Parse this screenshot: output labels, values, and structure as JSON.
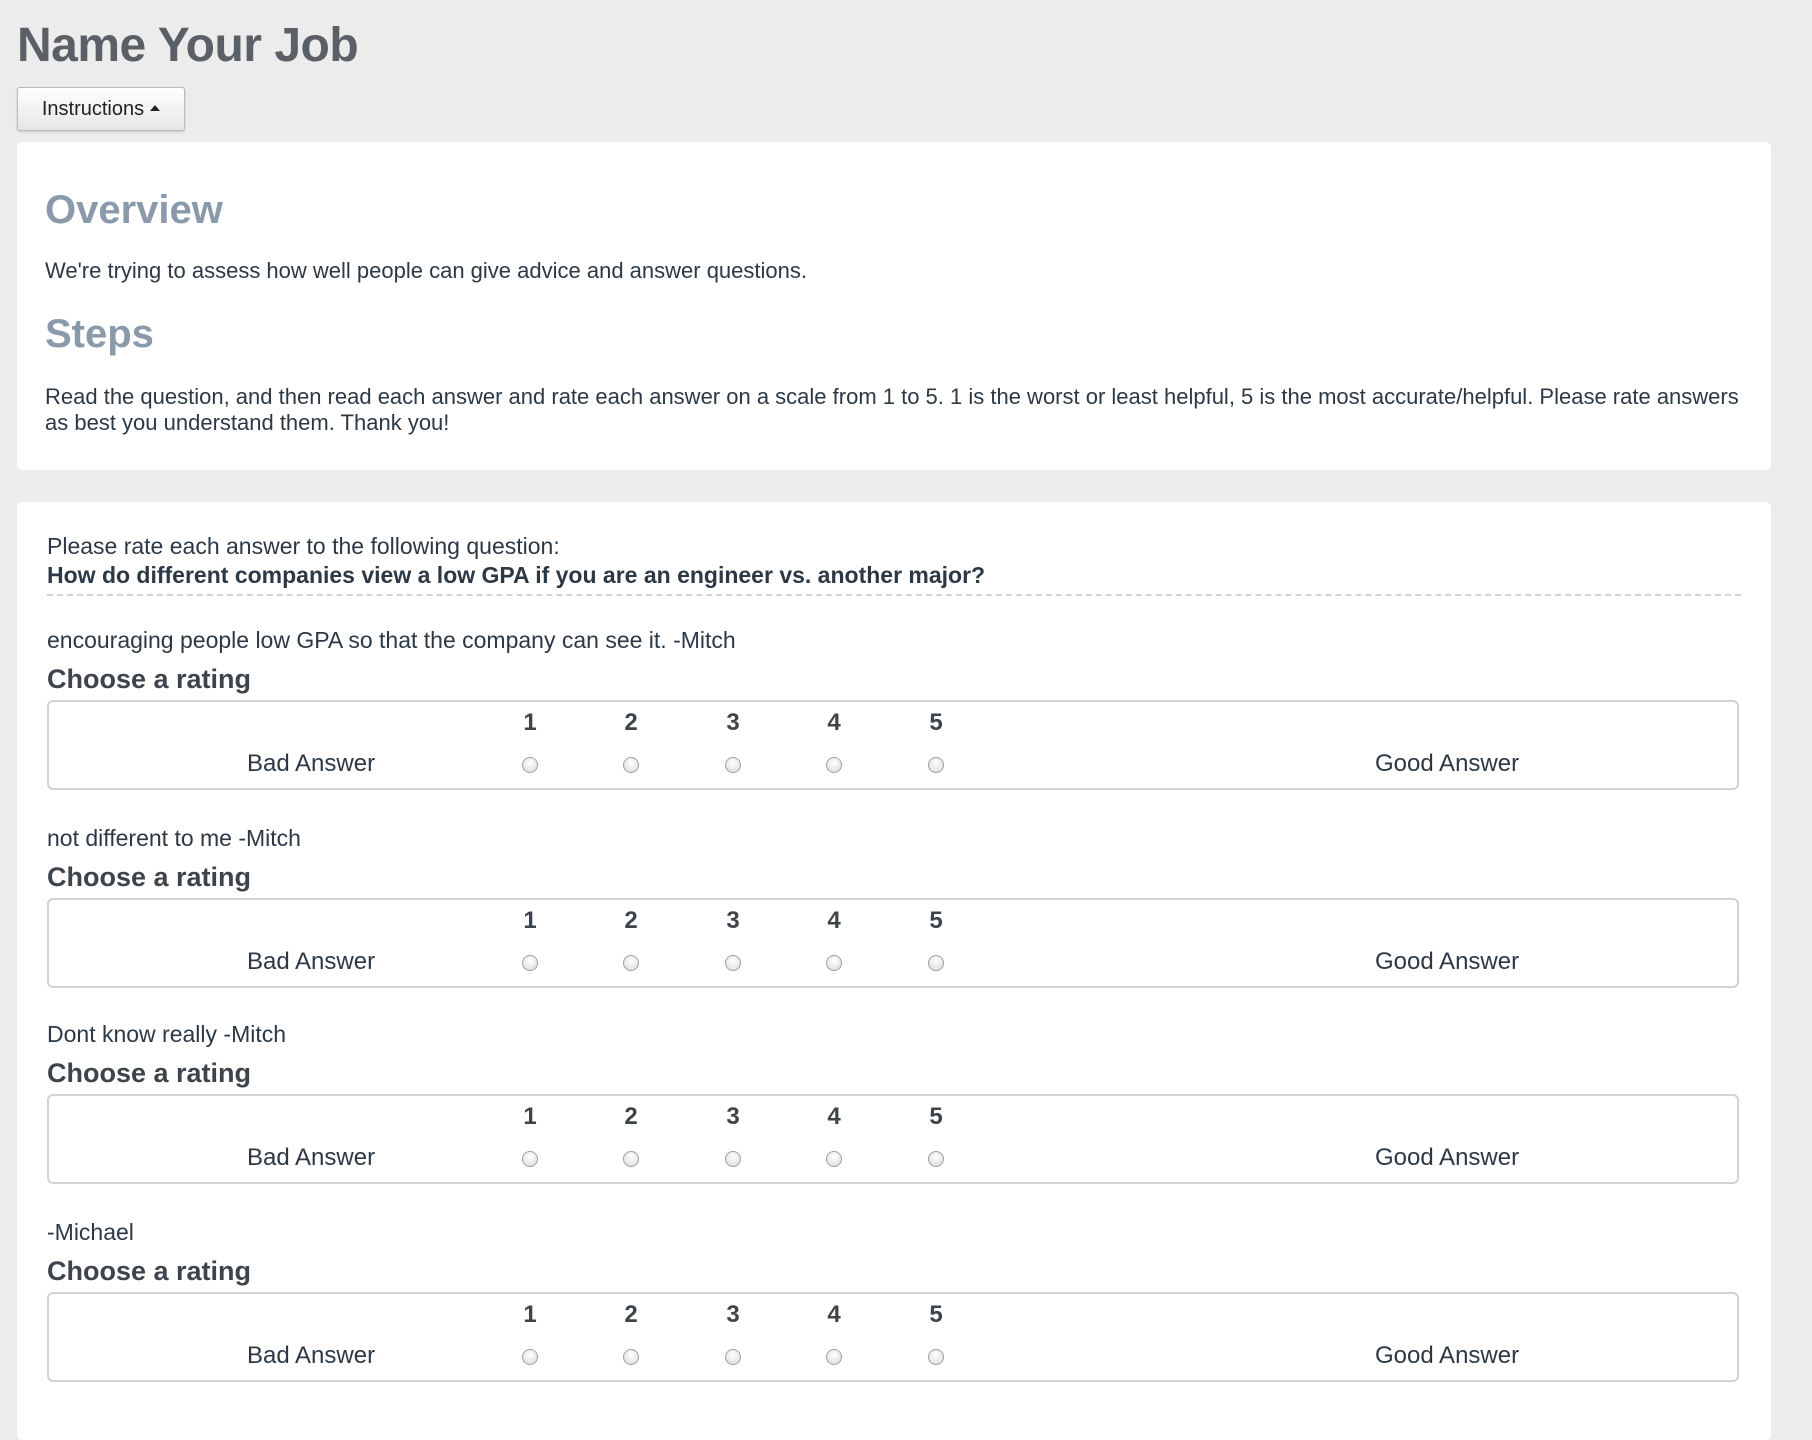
{
  "page": {
    "title": "Name Your Job"
  },
  "instructions_button": {
    "label": "Instructions"
  },
  "instructions": {
    "overview_heading": "Overview",
    "overview_text": "We're trying to assess how well people can give advice and answer questions.",
    "steps_heading": "Steps",
    "steps_text": "Read the question, and then read each answer and rate each answer on a scale from 1 to 5. 1 is the worst or least helpful, 5 is the most accurate/helpful. Please rate answers as best you understand them. Thank you!"
  },
  "task": {
    "prompt": "Please rate each answer to the following question:",
    "question": "How do different companies view a low GPA if you are an engineer vs. another major?",
    "rating_label": "Choose a rating",
    "bad_label": "Bad Answer",
    "good_label": "Good Answer",
    "scale": [
      "1",
      "2",
      "3",
      "4",
      "5"
    ],
    "answers": [
      {
        "text": "encouraging people low GPA so that the company can see it. -Mitch"
      },
      {
        "text": "not different to me -Mitch"
      },
      {
        "text": "Dont know really -Mitch"
      },
      {
        "text": "-Michael"
      }
    ]
  },
  "colors": {
    "background": "#ececec",
    "panel": "#ffffff",
    "heading_muted": "#8a9aab",
    "text": "#2c3945"
  }
}
